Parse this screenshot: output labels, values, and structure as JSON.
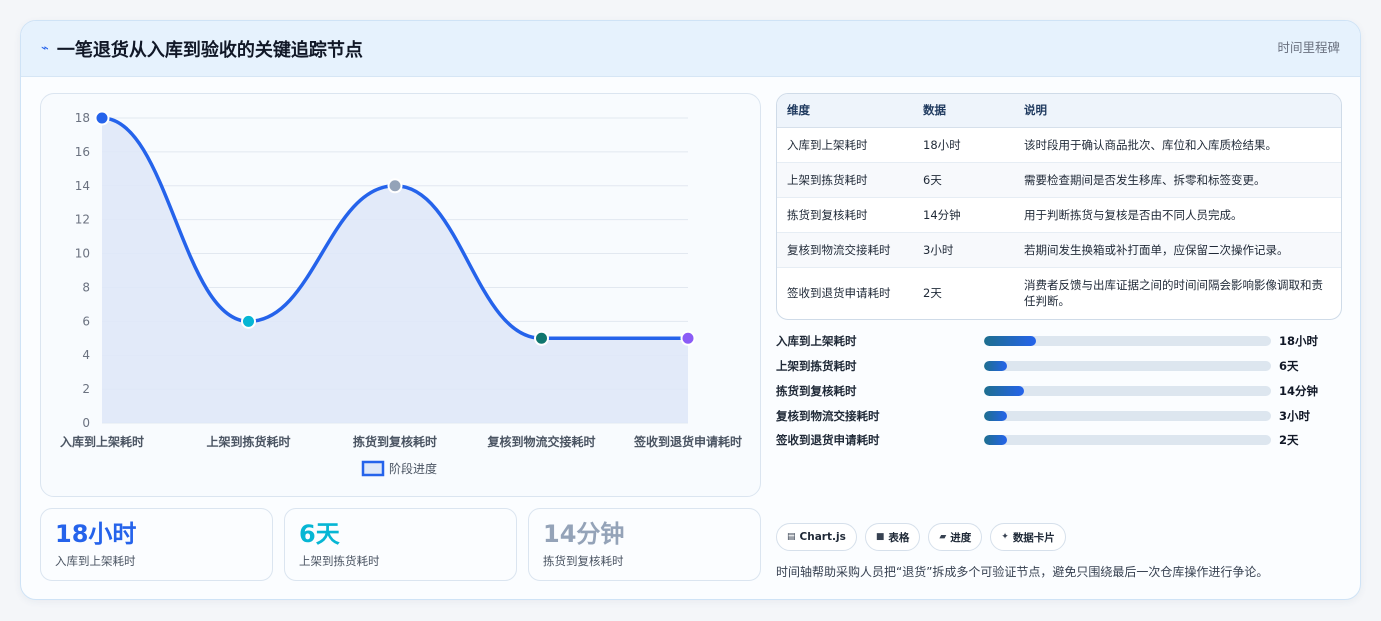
{
  "header": {
    "icon": "lightning-icon",
    "title": "一笔退货从入库到验收的关键追踪节点",
    "tag": "时间里程碑"
  },
  "chart_data": {
    "type": "line",
    "categories": [
      "入库到上架耗时",
      "上架到拣货耗时",
      "拣货到复核耗时",
      "复核到物流交接耗时",
      "签收到退货申请耗时"
    ],
    "series": [
      {
        "name": "阶段进度",
        "values": [
          18,
          6,
          14,
          5,
          5
        ]
      }
    ],
    "point_colors": [
      "#2563eb",
      "#06b6d4",
      "#94a3b8",
      "#0f766e",
      "#8b5cf6"
    ],
    "line_color": "#2563eb",
    "fill_color": "#dfe8f8",
    "ylim": [
      0,
      18
    ],
    "yticks": [
      0,
      2,
      4,
      6,
      8,
      10,
      12,
      14,
      16,
      18
    ],
    "legend_position": "bottom",
    "grid": true
  },
  "kpis": [
    {
      "value": "18小时",
      "label": "入库到上架耗时",
      "color": "#2563eb"
    },
    {
      "value": "6天",
      "label": "上架到拣货耗时",
      "color": "#06b6d4"
    },
    {
      "value": "14分钟",
      "label": "拣货到复核耗时",
      "color": "#94a3b8"
    }
  ],
  "table": {
    "headers": [
      "维度",
      "数据",
      "说明"
    ],
    "rows": [
      [
        "入库到上架耗时",
        "18小时",
        "该时段用于确认商品批次、库位和入库质检结果。"
      ],
      [
        "上架到拣货耗时",
        "6天",
        "需要检查期间是否发生移库、拆零和标签变更。"
      ],
      [
        "拣货到复核耗时",
        "14分钟",
        "用于判断拣货与复核是否由不同人员完成。"
      ],
      [
        "复核到物流交接耗时",
        "3小时",
        "若期间发生换箱或补打面单，应保留二次操作记录。"
      ],
      [
        "签收到退货申请耗时",
        "2天",
        "消费者反馈与出库证据之间的时间间隔会影响影像调取和责任判断。"
      ]
    ]
  },
  "progress": [
    {
      "label": "入库到上架耗时",
      "value": "18小时",
      "fraction": 0.18
    },
    {
      "label": "上架到拣货耗时",
      "value": "6天",
      "fraction": 0.08
    },
    {
      "label": "拣货到复核耗时",
      "value": "14分钟",
      "fraction": 0.14
    },
    {
      "label": "复核到物流交接耗时",
      "value": "3小时",
      "fraction": 0.08
    },
    {
      "label": "签收到退货申请耗时",
      "value": "2天",
      "fraction": 0.08
    }
  ],
  "chips": [
    {
      "icon": "chart-icon",
      "glyph": "▤",
      "label": "Chart.js"
    },
    {
      "icon": "table-icon",
      "glyph": "■",
      "label": "表格"
    },
    {
      "icon": "progress-icon",
      "glyph": "▰",
      "label": "进度"
    },
    {
      "icon": "card-icon",
      "glyph": "✦",
      "label": "数据卡片"
    }
  ],
  "note": "时间轴帮助采购人员把“退货”拆成多个可验证节点，避免只围绕最后一次仓库操作进行争论。"
}
